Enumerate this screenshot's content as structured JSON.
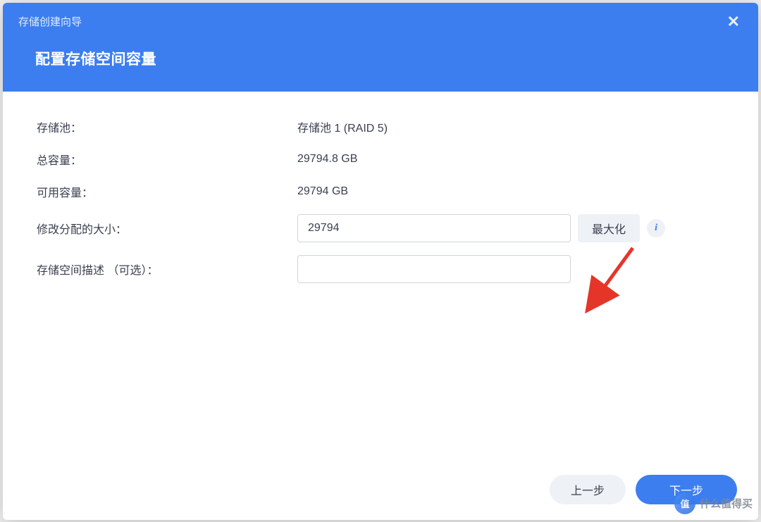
{
  "window": {
    "title": "存储创建向导",
    "subtitle": "配置存储空间容量"
  },
  "form": {
    "pool_label": "存储池：",
    "pool_value": "存储池 1 (RAID 5)",
    "total_label": "总容量：",
    "total_value": "29794.8 GB",
    "available_label": "可用容量：",
    "available_value": "29794 GB",
    "allocate_label": "修改分配的大小：",
    "allocate_value": "29794",
    "maximize_label": "最大化",
    "description_label": "存储空间描述 （可选）：",
    "description_value": ""
  },
  "buttons": {
    "prev": "上一步",
    "next": "下一步"
  },
  "watermark": {
    "badge": "值",
    "text": "什么值得买"
  }
}
